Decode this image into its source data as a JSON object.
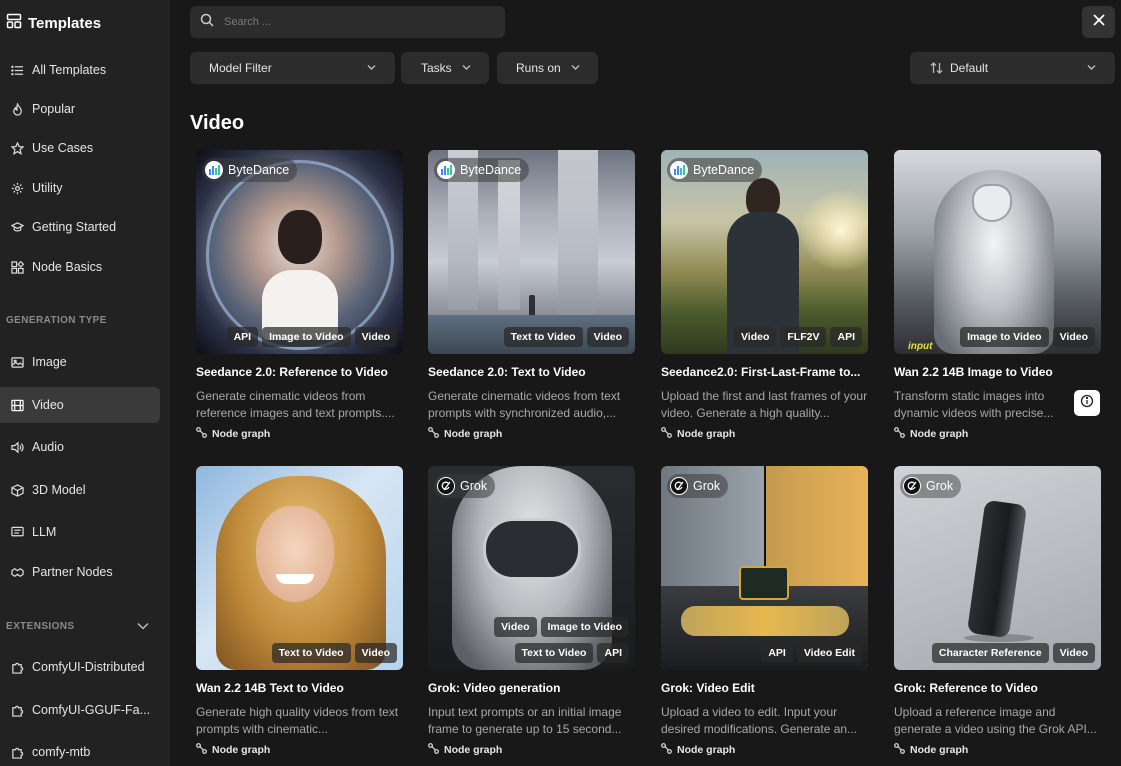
{
  "sidebar": {
    "title": "Templates",
    "items": [
      {
        "label": "All Templates",
        "icon": "list-icon"
      },
      {
        "label": "Popular",
        "icon": "flame-icon"
      },
      {
        "label": "Use Cases",
        "icon": "star-icon"
      },
      {
        "label": "Utility",
        "icon": "gear-icon"
      },
      {
        "label": "Getting Started",
        "icon": "graduation-cap-icon"
      },
      {
        "label": "Node Basics",
        "icon": "blocks-icon"
      }
    ],
    "generation_section": "GENERATION TYPE",
    "generation_items": [
      {
        "label": "Image",
        "icon": "image-icon"
      },
      {
        "label": "Video",
        "icon": "film-icon",
        "active": true
      },
      {
        "label": "Audio",
        "icon": "speaker-icon"
      },
      {
        "label": "3D Model",
        "icon": "cube-icon"
      },
      {
        "label": "LLM",
        "icon": "chat-icon"
      },
      {
        "label": "Partner Nodes",
        "icon": "handshake-icon"
      }
    ],
    "extensions_section": "EXTENSIONS",
    "extension_items": [
      {
        "label": "ComfyUI-Distributed",
        "icon": "puzzle-icon"
      },
      {
        "label": "ComfyUI-GGUF-Fa...",
        "icon": "puzzle-icon"
      },
      {
        "label": "comfy-mtb",
        "icon": "puzzle-icon"
      }
    ]
  },
  "search": {
    "placeholder": "Search ..."
  },
  "filters": {
    "model": "Model Filter",
    "tasks": "Tasks",
    "runs_on": "Runs on",
    "sort": "Default"
  },
  "section_title": "Video",
  "footer_label": "Node graph",
  "cards": [
    {
      "title": "Seedance 2.0: Reference to Video",
      "desc": "Generate cinematic videos from reference images and text prompts....",
      "brand": "ByteDance",
      "tags": [
        "API",
        "Image to Video",
        "Video"
      ]
    },
    {
      "title": "Seedance 2.0: Text to Video",
      "desc": "Generate cinematic videos from text prompts with synchronized audio,...",
      "brand": "ByteDance",
      "tags": [
        "Text to Video",
        "Video"
      ]
    },
    {
      "title": "Seedance2.0: First-Last-Frame to...",
      "desc": "Upload the first and last frames of your video. Generate a high quality...",
      "brand": "ByteDance",
      "tags": [
        "Video",
        "FLF2V",
        "API"
      ]
    },
    {
      "title": "Wan 2.2 14B Image to Video",
      "desc": "Transform static images into dynamic videos with precise...",
      "brand": "",
      "tags": [
        "Image to Video",
        "Video"
      ],
      "overlay": "input"
    },
    {
      "title": "Wan 2.2 14B Text to Video",
      "desc": "Generate high quality videos from text prompts with cinematic...",
      "brand": "",
      "tags": [
        "Text to Video",
        "Video"
      ]
    },
    {
      "title": "Grok: Video generation",
      "desc": "Input text prompts or an initial image frame to generate up to 15 second...",
      "brand": "Grok",
      "tags_row1": [
        "Video",
        "Image to Video"
      ],
      "tags": [
        "Text to Video",
        "API"
      ]
    },
    {
      "title": "Grok: Video Edit",
      "desc": "Upload a video to edit. Input your desired modifications. Generate an...",
      "brand": "Grok",
      "tags": [
        "API",
        "Video Edit"
      ]
    },
    {
      "title": "Grok: Reference to Video",
      "desc": "Upload a reference image and generate a video using the Grok API...",
      "brand": "Grok",
      "tags": [
        "Character Reference",
        "Video"
      ]
    }
  ]
}
